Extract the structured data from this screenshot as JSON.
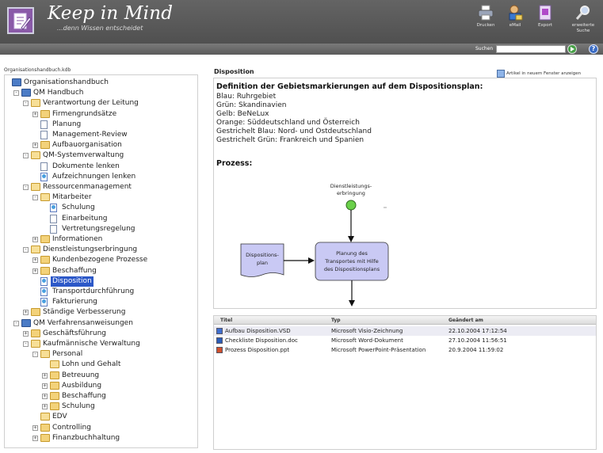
{
  "header": {
    "title": "Keep in Mind",
    "tagline": "...denn Wissen entscheidet",
    "tools": [
      {
        "label": "Drucken",
        "icon": "printer-icon"
      },
      {
        "label": "eMail",
        "icon": "email-icon"
      },
      {
        "label": "Export",
        "icon": "export-icon"
      },
      {
        "label": "erweiterte Suche",
        "icon": "advanced-search-icon"
      }
    ]
  },
  "search": {
    "label": "Suchen",
    "value": "",
    "placeholder": ""
  },
  "left": {
    "file_label": "Organisationshandbuch.kdb"
  },
  "tree": [
    {
      "label": "Organisationshandbuch",
      "depth": 0,
      "icon": "books",
      "toggle": ""
    },
    {
      "label": "QM Handbuch",
      "depth": 1,
      "icon": "books",
      "toggle": "-"
    },
    {
      "label": "Verantwortung der Leitung",
      "depth": 2,
      "icon": "folder-open",
      "toggle": "-"
    },
    {
      "label": "Firmengrundsätze",
      "depth": 3,
      "icon": "folder",
      "toggle": "+"
    },
    {
      "label": "Planung",
      "depth": 3,
      "icon": "doc",
      "toggle": ""
    },
    {
      "label": "Management-Review",
      "depth": 3,
      "icon": "doc",
      "toggle": ""
    },
    {
      "label": "Aufbauorganisation",
      "depth": 3,
      "icon": "folder",
      "toggle": "+"
    },
    {
      "label": "QM-Systemverwaltung",
      "depth": 2,
      "icon": "folder-open",
      "toggle": "-"
    },
    {
      "label": "Dokumente lenken",
      "depth": 3,
      "icon": "doc",
      "toggle": ""
    },
    {
      "label": "Aufzeichnungen lenken",
      "depth": 3,
      "icon": "docp",
      "toggle": ""
    },
    {
      "label": "Ressourcenmanagement",
      "depth": 2,
      "icon": "folder-open",
      "toggle": "-"
    },
    {
      "label": "Mitarbeiter",
      "depth": 3,
      "icon": "folder-open",
      "toggle": "-"
    },
    {
      "label": "Schulung",
      "depth": 4,
      "icon": "docp",
      "toggle": ""
    },
    {
      "label": "Einarbeitung",
      "depth": 4,
      "icon": "doc",
      "toggle": ""
    },
    {
      "label": "Vertretungsregelung",
      "depth": 4,
      "icon": "doc",
      "toggle": ""
    },
    {
      "label": "Informationen",
      "depth": 3,
      "icon": "folder",
      "toggle": "+"
    },
    {
      "label": "Dienstleistungserbringung",
      "depth": 2,
      "icon": "folder-open",
      "toggle": "-"
    },
    {
      "label": "Kundenbezogene Prozesse",
      "depth": 3,
      "icon": "folder",
      "toggle": "+"
    },
    {
      "label": "Beschaffung",
      "depth": 3,
      "icon": "folder",
      "toggle": "+"
    },
    {
      "label": "Disposition",
      "depth": 3,
      "icon": "docp",
      "toggle": "",
      "selected": true
    },
    {
      "label": "Transportdurchführung",
      "depth": 3,
      "icon": "docp",
      "toggle": ""
    },
    {
      "label": "Fakturierung",
      "depth": 3,
      "icon": "docp",
      "toggle": ""
    },
    {
      "label": "Ständige Verbesserung",
      "depth": 2,
      "icon": "folder",
      "toggle": "+"
    },
    {
      "label": "QM Verfahrensanweisungen",
      "depth": 1,
      "icon": "books",
      "toggle": "-"
    },
    {
      "label": "Geschäftsführung",
      "depth": 2,
      "icon": "folder",
      "toggle": "+"
    },
    {
      "label": "Kaufmännische Verwaltung",
      "depth": 2,
      "icon": "folder-open",
      "toggle": "-"
    },
    {
      "label": "Personal",
      "depth": 3,
      "icon": "folder-open",
      "toggle": "-"
    },
    {
      "label": "Lohn und Gehalt",
      "depth": 4,
      "icon": "folder-open",
      "toggle": ""
    },
    {
      "label": "Betreuung",
      "depth": 4,
      "icon": "folder",
      "toggle": "+"
    },
    {
      "label": "Ausbildung",
      "depth": 4,
      "icon": "folder",
      "toggle": "+"
    },
    {
      "label": "Beschaffung",
      "depth": 4,
      "icon": "folder",
      "toggle": "+"
    },
    {
      "label": "Schulung",
      "depth": 4,
      "icon": "folder",
      "toggle": "+"
    },
    {
      "label": "EDV",
      "depth": 3,
      "icon": "folder-open",
      "toggle": ""
    },
    {
      "label": "Controlling",
      "depth": 3,
      "icon": "folder",
      "toggle": "+"
    },
    {
      "label": "Finanzbuchhaltung",
      "depth": 3,
      "icon": "folder",
      "toggle": "+"
    }
  ],
  "article": {
    "title": "Disposition",
    "open_new_window": "Artikel in neuem Fenster anzeigen",
    "definition_title": "Definition der Gebietsmarkierungen auf dem Dispositionsplan:",
    "lines": [
      "Blau: Ruhrgebiet",
      "Grün: Skandinavien",
      "Gelb: BeNeLux",
      "Orange: Süddeutschland und Österreich",
      "Gestrichelt Blau: Nord- und Ostdeutschland",
      "Gestrichelt Grün: Frankreich und Spanien"
    ],
    "process_title": "Prozess:",
    "diagram": {
      "start_label_1": "Dienstleistungs-",
      "start_label_2": "erbringung",
      "doc_label_1": "Dispositions-",
      "doc_label_2": "plan",
      "process_label_1": "Planung des",
      "process_label_2": "Transportes mit Hilfe",
      "process_label_3": "des Dispositionsplans"
    }
  },
  "files": {
    "columns": [
      "Titel",
      "Typ",
      "Geändert am"
    ],
    "rows": [
      {
        "name": "Aufbau Disposition.VSD",
        "type": "Microsoft Visio-Zeichnung",
        "date": "22.10.2004 17:12:54",
        "icon_color": "#3f6fd0"
      },
      {
        "name": "Checkliste Disposition.doc",
        "type": "Microsoft Word-Dokument",
        "date": "27.10.2004 11:56:51",
        "icon_color": "#2b5db8"
      },
      {
        "name": "Prozess Disposition.ppt",
        "type": "Microsoft PowerPoint-Präsentation",
        "date": "20.9.2004 11:59:02",
        "icon_color": "#d0502c"
      }
    ]
  },
  "colors": {
    "header": "#575757",
    "selection": "#2c58c8",
    "process_fill": "#c9c9f4",
    "doc_fill": "#c9c9f4",
    "start_fill": "#6ad04a"
  }
}
